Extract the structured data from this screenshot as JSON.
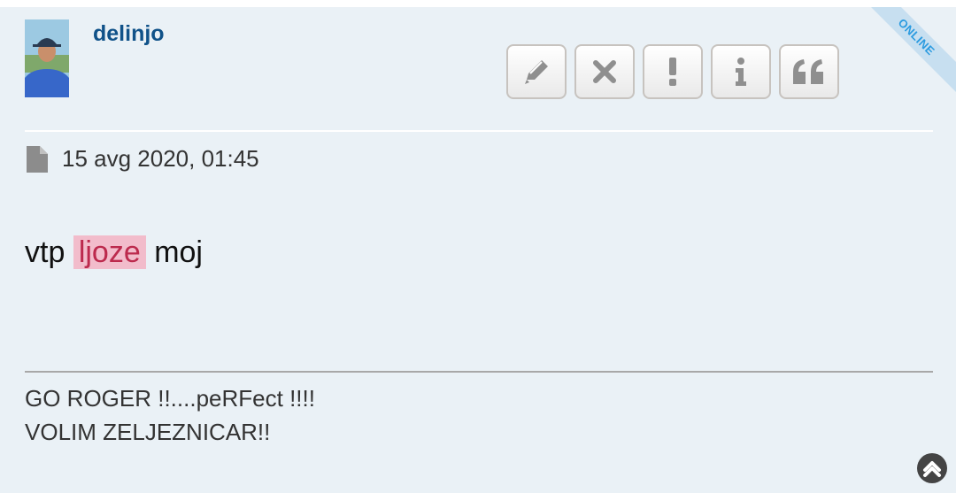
{
  "post": {
    "username": "delinjo",
    "status_ribbon": "ONLINE",
    "date": "15 avg 2020, 01:45",
    "content": {
      "before": "vtp",
      "highlight": "ljoze",
      "after": "moj"
    },
    "signature": {
      "line1": "GO ROGER !!....peRFect !!!!",
      "line2": "VOLIM ZELJEZNICAR!!"
    }
  },
  "buttons": [
    {
      "icon": "pencil-icon",
      "action": "edit"
    },
    {
      "icon": "close-icon",
      "action": "delete"
    },
    {
      "icon": "exclamation-icon",
      "action": "report"
    },
    {
      "icon": "info-icon",
      "action": "info"
    },
    {
      "icon": "quote-icon",
      "action": "quote"
    }
  ],
  "colors": {
    "username": "#105289",
    "highlight_bg": "#f2bccb",
    "highlight_text": "#bc2a4d",
    "online": "#2b9be0",
    "post_bg": "#eaf1f6"
  }
}
